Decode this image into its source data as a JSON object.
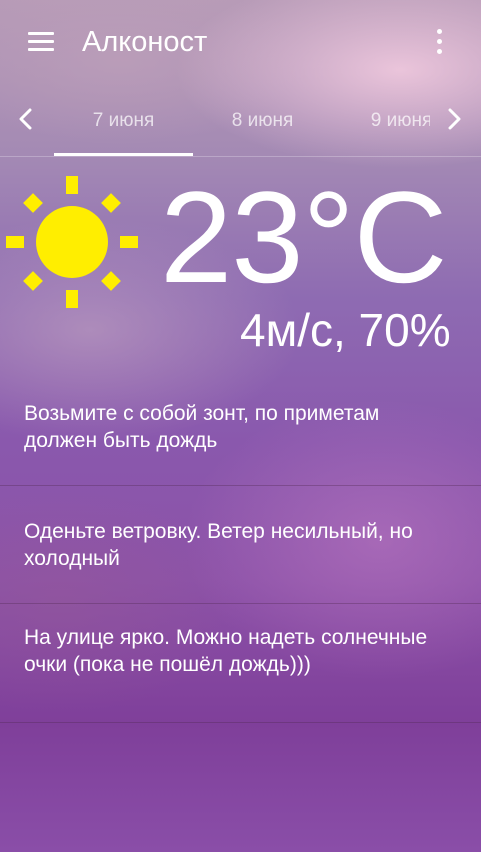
{
  "app": {
    "title": "Алконост"
  },
  "icons": {
    "menu": "hamburger-menu-icon",
    "more": "more-vert-icon",
    "prev": "chevron-left-icon",
    "next": "chevron-right-icon",
    "weather": "sun-icon"
  },
  "dates": {
    "tabs": [
      "7 июня",
      "8 июня",
      "9 июня"
    ],
    "active_index": 0
  },
  "weather": {
    "temperature": "23°C",
    "wind_humidity": "4м/с, 70%"
  },
  "advice": [
    "Возьмите с собой зонт, по приметам должен быть дождь",
    "Оденьте ветровку. Ветер несильный, но холодный",
    "На улице ярко. Можно надеть солнечные очки (пока не пошёл дождь)))"
  ],
  "colors": {
    "sun": "#ffee00",
    "text": "#ffffff"
  }
}
